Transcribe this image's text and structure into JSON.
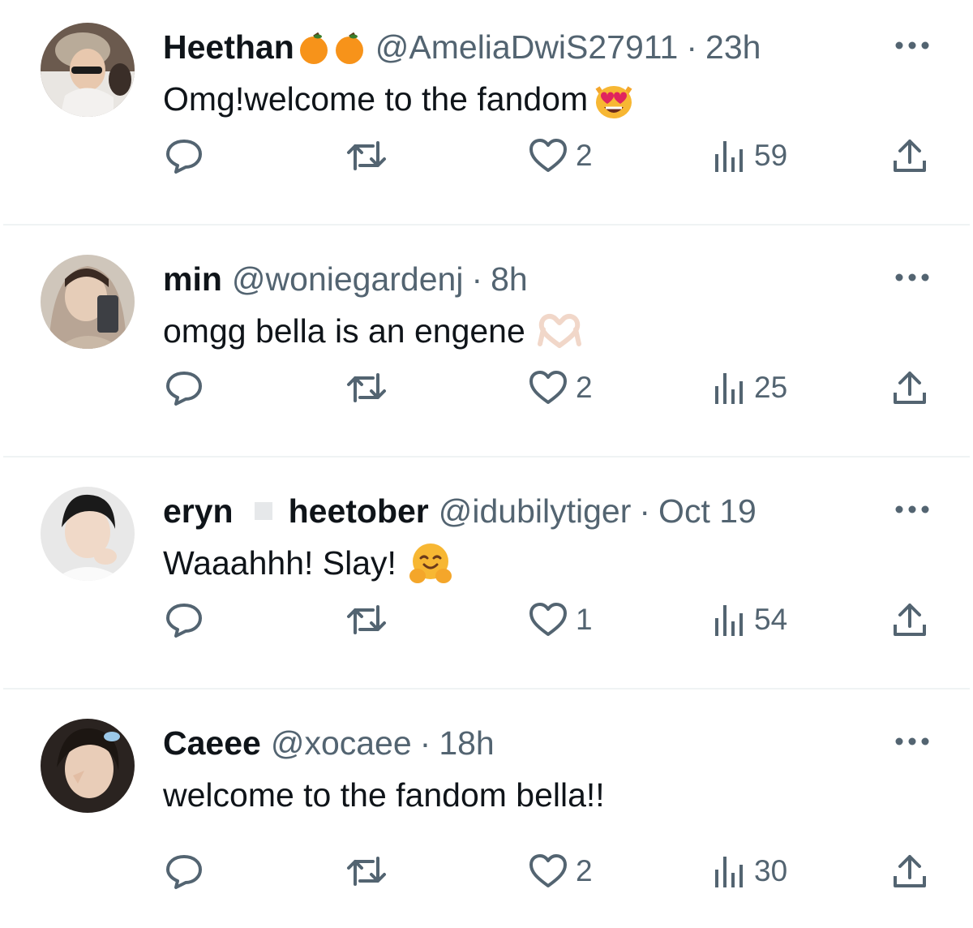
{
  "tweets": [
    {
      "name": "Heethan",
      "badges": [
        "orange-icon",
        "orange-icon"
      ],
      "handle": "@AmeliaDwiS27911",
      "time": "23h",
      "text": "Omg!welcome to the fandom",
      "emoji": "heart-eyes-cat-icon",
      "replies": "",
      "retweets": "",
      "likes": "2",
      "views": "59"
    },
    {
      "name": "min",
      "handle": "@woniegardenj",
      "time": "8h",
      "text": "omgg bella is an engene",
      "emoji": "heart-hands-icon",
      "likes": "2",
      "views": "25"
    },
    {
      "name": "eryn",
      "name_secondary": "heetober",
      "handle": "@idubilytiger",
      "time": "Oct 19",
      "text": "Waaahhh! Slay!",
      "emoji": "hugging-face-icon",
      "likes": "1",
      "views": "54"
    },
    {
      "name": "Caeee",
      "handle": "@xocaee",
      "time": "18h",
      "text": "welcome to the fandom bella!!",
      "likes": "2",
      "views": "30"
    }
  ],
  "separator": "·",
  "colors": {
    "text": "#0f1419",
    "secondary": "#536471",
    "divider": "#eff3f4",
    "orange": "#f7931a"
  }
}
